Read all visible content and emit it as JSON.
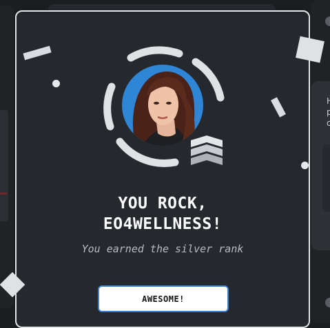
{
  "background": {
    "right_card_text": [
      "H",
      "p",
      "c"
    ]
  },
  "modal": {
    "title_line1": "YOU ROCK,",
    "title_line2": "EO4WELLNESS!",
    "subtitle": "You earned the silver rank",
    "button_label": "AWESOME!",
    "rank": "silver",
    "avatar_icon": "user-avatar"
  },
  "colors": {
    "modal_bg": "#25282c",
    "modal_border": "#e3e5e8",
    "confetti": "#d9dce0",
    "button_border": "#3d7fd0",
    "avatar_bg": "#2f86d6"
  }
}
